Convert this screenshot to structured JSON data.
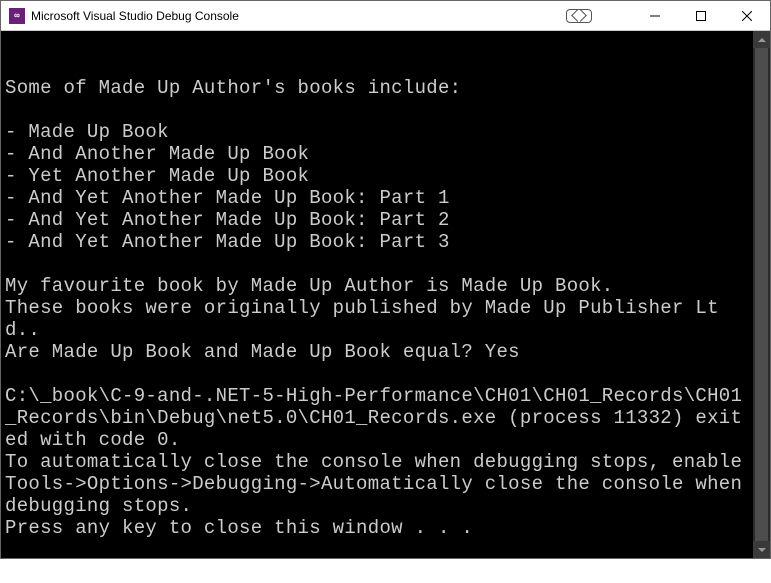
{
  "window": {
    "title": "Microsoft Visual Studio Debug Console",
    "icon_label": "VS"
  },
  "console": {
    "lines": [
      "Some of Made Up Author's books include:",
      "",
      "- Made Up Book",
      "- And Another Made Up Book",
      "- Yet Another Made Up Book",
      "- And Yet Another Made Up Book: Part 1",
      "- And Yet Another Made Up Book: Part 2",
      "- And Yet Another Made Up Book: Part 3",
      "",
      "My favourite book by Made Up Author is Made Up Book.",
      "These books were originally published by Made Up Publisher Ltd..",
      "Are Made Up Book and Made Up Book equal? Yes",
      "",
      "C:\\_book\\C-9-and-.NET-5-High-Performance\\CH01\\CH01_Records\\CH01_Records\\bin\\Debug\\net5.0\\CH01_Records.exe (process 11332) exited with code 0.",
      "To automatically close the console when debugging stops, enable Tools->Options->Debugging->Automatically close the console when debugging stops.",
      "Press any key to close this window . . ."
    ]
  }
}
